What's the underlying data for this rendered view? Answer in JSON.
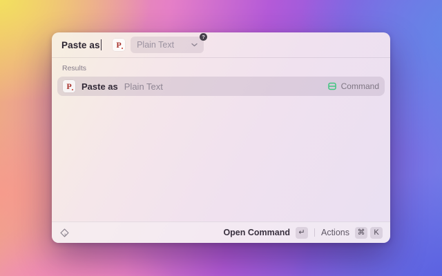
{
  "window": {
    "search": {
      "query": "Paste as",
      "icon_glyph": "P",
      "argument_value": "Plain Text",
      "badge": "?"
    },
    "results": {
      "section_label": "Results",
      "items": [
        {
          "icon_glyph": "P",
          "title": "Paste as",
          "subtitle": "Plain Text",
          "type": "Command"
        }
      ]
    },
    "footer": {
      "primary_action": "Open Command",
      "primary_key": "↵",
      "actions_label": "Actions",
      "actions_keys": [
        "⌘",
        "K"
      ]
    }
  },
  "colors": {
    "command_type_green": "#3fc57f",
    "extension_icon_red": "#a8322c",
    "row_highlight": "rgba(150,130,160,0.22)"
  }
}
